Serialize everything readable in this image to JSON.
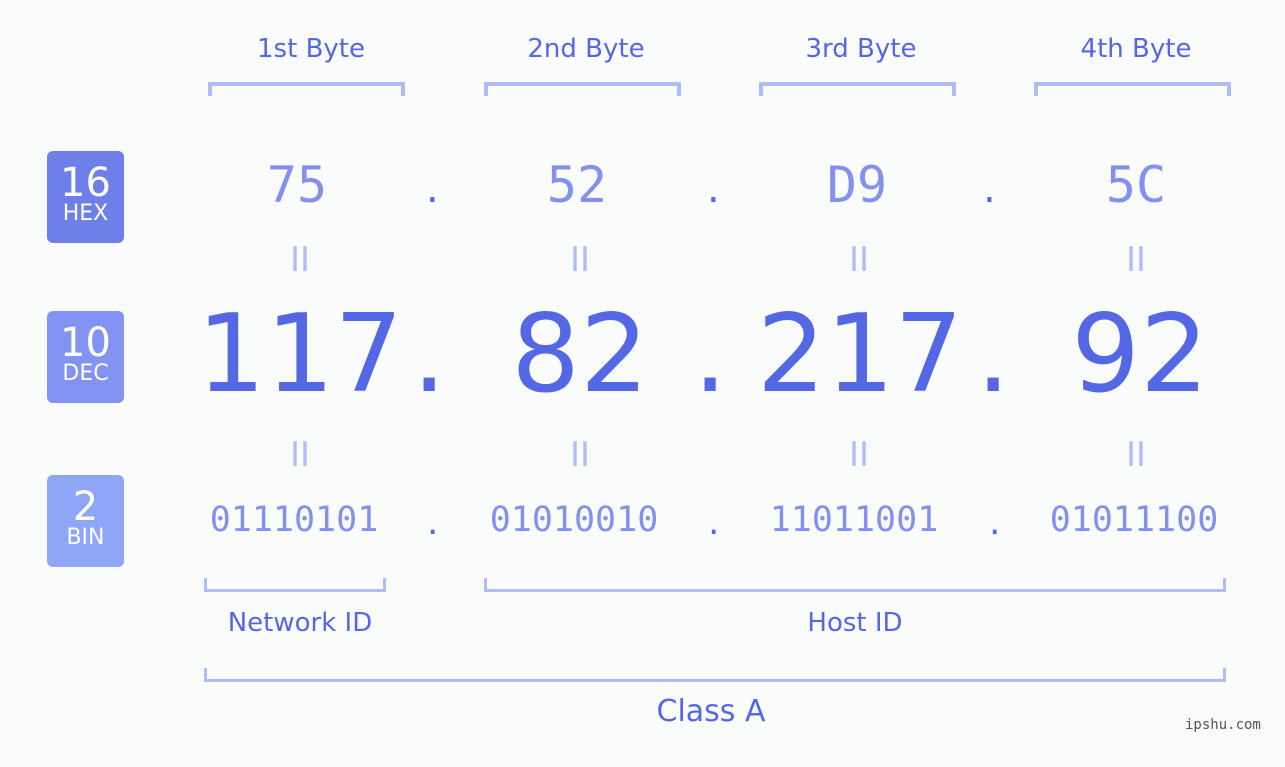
{
  "bytes": {
    "labels": [
      "1st Byte",
      "2nd Byte",
      "3rd Byte",
      "4th Byte"
    ]
  },
  "badges": {
    "hex": {
      "num": "16",
      "label": "HEX",
      "color": "#6f7fe9"
    },
    "dec": {
      "num": "10",
      "label": "DEC",
      "color": "#8393f3"
    },
    "bin": {
      "num": "2",
      "label": "BIN",
      "color": "#8fa6f6"
    }
  },
  "hex": [
    "75",
    "52",
    "D9",
    "5C"
  ],
  "dec": [
    "117",
    "82",
    "217",
    "92"
  ],
  "bin": [
    "01110101",
    "01010010",
    "11011001",
    "01011100"
  ],
  "separator": ".",
  "equals": "II",
  "sections": {
    "network_id": "Network ID",
    "host_id": "Host ID",
    "class": "Class A"
  },
  "watermark": "ipshu.com",
  "colors": {
    "primary": "#5468e6",
    "secondary": "#8290ef",
    "bracket": "#b0bcf7"
  }
}
